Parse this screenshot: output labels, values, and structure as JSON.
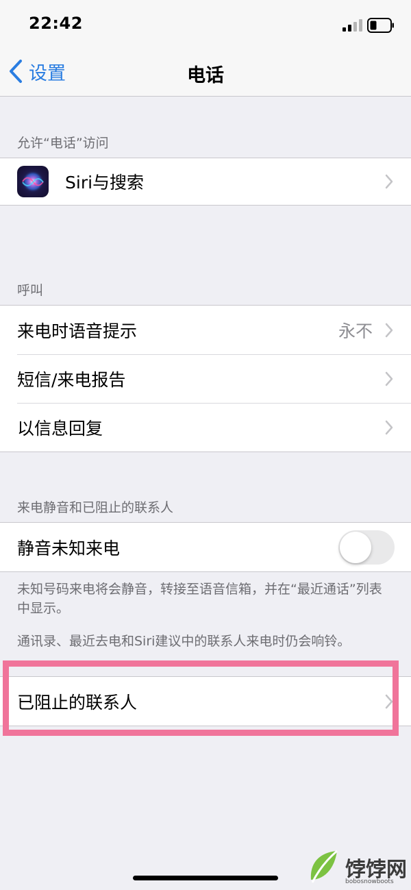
{
  "status_bar": {
    "time": "22:42",
    "signal_icon": "signal-icon",
    "battery_icon": "battery-icon"
  },
  "nav": {
    "back_label": "设置",
    "title": "电话"
  },
  "sections": {
    "allow_access": {
      "header": "允许“电话”访问",
      "siri_label": "Siri与搜索"
    },
    "calls": {
      "header": "呼叫",
      "items": [
        {
          "label": "来电时语音提示",
          "value": "永不"
        },
        {
          "label": "短信/来电报告",
          "value": ""
        },
        {
          "label": "以信息回复",
          "value": ""
        }
      ]
    },
    "silence": {
      "header": "来电静音和已阻止的联系人",
      "silence_label": "静音未知来电",
      "silence_on": false,
      "footer_1": "未知号码来电将会静音，转接至语音信箱，并在“最近通话”列表中显示。",
      "footer_2": "通讯录、最近去电和Siri建议中的联系人来电时仍会响铃。",
      "blocked_label": "已阻止的联系人"
    }
  },
  "colors": {
    "accent": "#2a7de1",
    "background": "#efeff4",
    "highlight": "#f0749a"
  },
  "watermark": {
    "text": "饽饽网",
    "sub": "bobosnowboots"
  }
}
